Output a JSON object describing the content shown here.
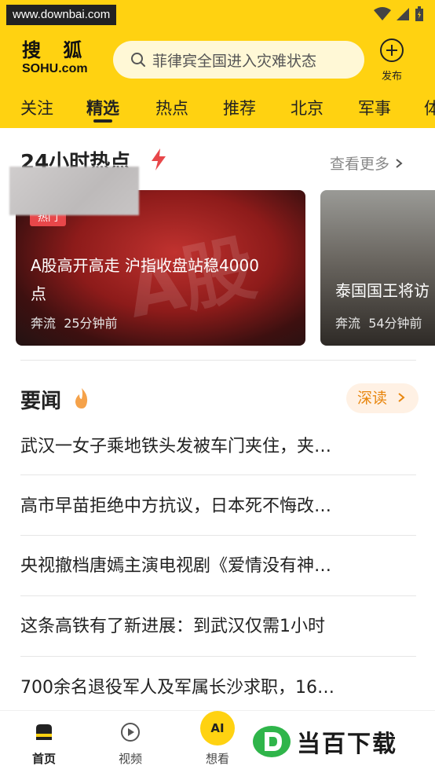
{
  "statusbar": {
    "watermark": "www.downbai.com"
  },
  "header": {
    "logo_cn": "搜  狐",
    "logo_en": "SOHU.com",
    "search_placeholder": "菲律宾全国进入灾难状态",
    "publish_label": "发布"
  },
  "tabs": [
    "关注",
    "精选",
    "热点",
    "推荐",
    "北京",
    "军事",
    "体"
  ],
  "active_tab": "精选",
  "hot": {
    "title": "24小时热点",
    "more": "查看更多",
    "cards": [
      {
        "badge": "热门",
        "title": "A股高开高走 沪指收盘站稳4000点",
        "source": "奔流",
        "time": "25分钟前",
        "bg_text": "A股"
      },
      {
        "title": "泰国国王将访",
        "source": "奔流",
        "time": "54分钟前"
      }
    ]
  },
  "news": {
    "title": "要闻",
    "deep_read": "深读",
    "items": [
      "武汉一女子乘地铁头发被车门夹住，夹…",
      "高市早苗拒绝中方抗议，日本死不悔改…",
      "央视撤档唐嫣主演电视剧《爱情没有神…",
      "这条高铁有了新进展：到武汉仅需1小时",
      "700余名退役军人及军属长沙求职，16…"
    ]
  },
  "bottom_nav": {
    "home": "首页",
    "video": "视频",
    "ai_icon": "AI",
    "think": "想看",
    "brand_watermark": "当百下载"
  },
  "colors": {
    "brand_yellow": "#ffd211",
    "hot_red": "#e8474a",
    "deep_orange": "#e8860e"
  }
}
